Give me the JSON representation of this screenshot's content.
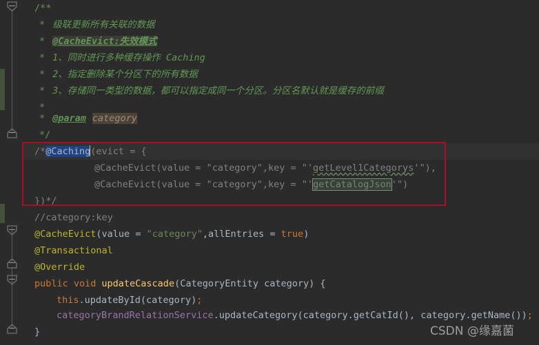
{
  "editor": {
    "theme_background": "#2b2b2b",
    "gutter_background": "#313335",
    "change_bar_color": "#43523c",
    "annotation_box_color": "#a3122a",
    "selection_color": "#214283",
    "search_highlight_color": "#32593d"
  },
  "watermark": {
    "text": "CSDN @缘嘉菌"
  },
  "code": {
    "doc_open": "/**",
    "doc_line_1_star": "*",
    "doc_line_1_text": "级联更新所有关联的数据",
    "doc_line_2_star": "*",
    "doc_line_2_text": "@CacheEvict:失效模式",
    "doc_line_3_star": "*",
    "doc_line_3_text": "1、同时进行多种缓存操作 Caching",
    "doc_line_4_star": "*",
    "doc_line_4_text": "2、指定删除某个分区下的所有数据",
    "doc_line_5_star": "*",
    "doc_line_5_text": "3、存储同一类型的数据，都可以指定成同一个分区。分区名默认就是缓存的前缀",
    "doc_line_6_star": "*",
    "doc_param_star": "*",
    "doc_param_tag": "@param",
    "doc_param_value": "category",
    "doc_close": "*/",
    "commented_open": "/*",
    "commented_anno": "@Caching",
    "commented_open_tail": "(evict = {",
    "commented_evict_1_head": "@CacheEvict(value = ",
    "commented_evict_1_str": "\"category\"",
    "commented_evict_1_mid": ",key = \"'",
    "commented_evict_1_key": "getLevel1Categorys",
    "commented_evict_1_tail": "'\"),",
    "commented_evict_2_head": "@CacheEvict(value = ",
    "commented_evict_2_str": "\"category\"",
    "commented_evict_2_mid": ",key = \"'",
    "commented_evict_2_key": "getCatalogJson",
    "commented_evict_2_tail": "'\")",
    "commented_close": "})*/",
    "note_comment": "//category:key",
    "cacheevict_anno": "@CacheEvict",
    "cacheevict_p1": "(",
    "cacheevict_attr1": "value",
    "cacheevict_eq1": " = ",
    "cacheevict_str": "\"category\"",
    "cacheevict_comma": ",",
    "cacheevict_attr2": "allEntries",
    "cacheevict_eq2": " = ",
    "cacheevict_true": "true",
    "cacheevict_p2": ")",
    "transactional_anno": "@Transactional",
    "override_anno": "@Override",
    "method_mod": "public void",
    "method_name": "updateCascade",
    "method_params": "(CategoryEntity category) {",
    "body_this": "this",
    "body_this_call": ".updateById(category)",
    "body_this_semi": ";",
    "body_field": "categoryBrandRelationService",
    "body_field_call": ".updateCategory(category.getCatId(), category.getName())",
    "body_field_semi": ";",
    "method_close": "}"
  },
  "gutter": {
    "fold_markers": [
      {
        "name": "fold-marker-collapse-doc",
        "shape": "chevron-down"
      },
      {
        "name": "fold-marker-expand-region",
        "shape": "chevron-up"
      },
      {
        "name": "fold-marker-collapse-anno",
        "shape": "chevron-down"
      },
      {
        "name": "fold-marker-expand-anno",
        "shape": "chevron-up"
      },
      {
        "name": "fold-marker-collapse-method",
        "shape": "chevron-down"
      },
      {
        "name": "fold-marker-expand-method",
        "shape": "chevron-up"
      }
    ]
  }
}
